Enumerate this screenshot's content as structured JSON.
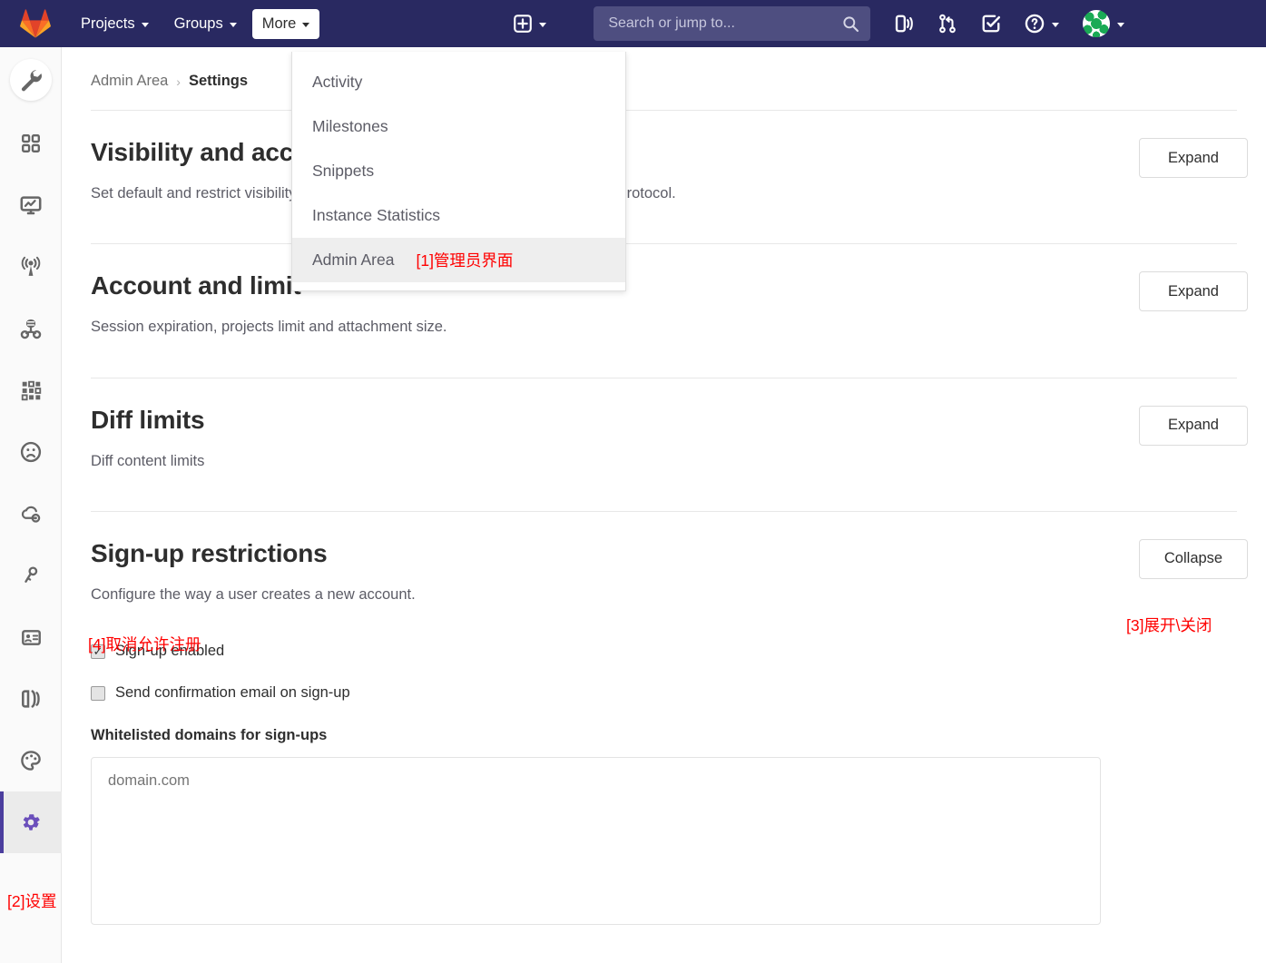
{
  "topnav": {
    "logo_icon": "gitlab-logo-icon",
    "items": [
      {
        "label": "Projects",
        "icon": "chevron-down-icon",
        "active": false
      },
      {
        "label": "Groups",
        "icon": "chevron-down-icon",
        "active": false
      },
      {
        "label": "More",
        "icon": "chevron-down-icon",
        "active": true
      }
    ],
    "create_new_icon": "plus-square-icon",
    "create_new_caret_icon": "chevron-down-icon",
    "search": {
      "placeholder": "Search or jump to...",
      "value": "",
      "icon": "search-icon"
    },
    "icons": [
      {
        "name": "issues-board-icon"
      },
      {
        "name": "merge-request-icon"
      },
      {
        "name": "todos-checkbox-icon"
      },
      {
        "name": "help-question-icon"
      }
    ],
    "help_caret_icon": "chevron-down-icon",
    "avatar_icon": "user-avatar",
    "avatar_caret_icon": "chevron-down-icon"
  },
  "more_menu": {
    "items": [
      {
        "label": "Activity",
        "highlighted": false,
        "note": ""
      },
      {
        "label": "Milestones",
        "highlighted": false,
        "note": ""
      },
      {
        "label": "Snippets",
        "highlighted": false,
        "note": ""
      },
      {
        "label": "Instance Statistics",
        "highlighted": false,
        "note": ""
      },
      {
        "label": "Admin Area",
        "highlighted": true,
        "note": "[1]管理员界面"
      }
    ]
  },
  "sidebar": {
    "items": [
      {
        "icon": "wrench-icon",
        "name": "admin-overview",
        "current": false,
        "top": true
      },
      {
        "icon": "overview-grid-icon",
        "name": "overview",
        "current": false
      },
      {
        "icon": "monitoring-screen-icon",
        "name": "monitoring",
        "current": false
      },
      {
        "icon": "messages-broadcast-icon",
        "name": "messages",
        "current": false
      },
      {
        "icon": "system-hooks-icon",
        "name": "system-hooks",
        "current": false
      },
      {
        "icon": "applications-grid-icon",
        "name": "applications",
        "current": false
      },
      {
        "icon": "abuse-reports-icon",
        "name": "abuse-reports",
        "current": false
      },
      {
        "icon": "kubernetes-cloud-icon",
        "name": "kubernetes",
        "current": false
      },
      {
        "icon": "deploy-keys-icon",
        "name": "deploy-keys",
        "current": false
      },
      {
        "icon": "license-card-icon",
        "name": "license",
        "current": false
      },
      {
        "icon": "push-rules-icon",
        "name": "push-rules",
        "current": false
      },
      {
        "icon": "geo-palette-icon",
        "name": "geo",
        "current": false
      },
      {
        "icon": "gear-icon",
        "name": "settings",
        "current": true
      }
    ]
  },
  "breadcrumb": {
    "root": "Admin Area",
    "separator": "›",
    "current": "Settings"
  },
  "sections": [
    {
      "title": "Visibility and access controls",
      "description": "Set default and restrict visibility levels. Configure import sources and git access protocol.",
      "button": "Expand",
      "expanded": false
    },
    {
      "title": "Account and limit",
      "description": "Session expiration, projects limit and attachment size.",
      "button": "Expand",
      "expanded": false
    },
    {
      "title": "Diff limits",
      "description": "Diff content limits",
      "button": "Expand",
      "expanded": false
    },
    {
      "title": "Sign-up restrictions",
      "description": "Configure the way a user creates a new account.",
      "button": "Collapse",
      "expanded": true
    }
  ],
  "signup_form": {
    "checkboxes": [
      {
        "label": "Sign-up enabled",
        "checked": true
      },
      {
        "label": "Send confirmation email on sign-up",
        "checked": false
      }
    ],
    "domains_label": "Whitelisted domains for sign-ups",
    "domains_placeholder": "domain.com",
    "domains_value": ""
  },
  "annotations": {
    "a1": "[1]管理员界面",
    "a2": "[2]设置",
    "a3": "[3]展开\\关闭",
    "a4": "[4]取消允许注册"
  },
  "colors": {
    "nav_bg": "#292961",
    "annotation": "#ff0000",
    "active_accent": "#4b3e9e",
    "sidebar_bg": "#fafafa"
  }
}
